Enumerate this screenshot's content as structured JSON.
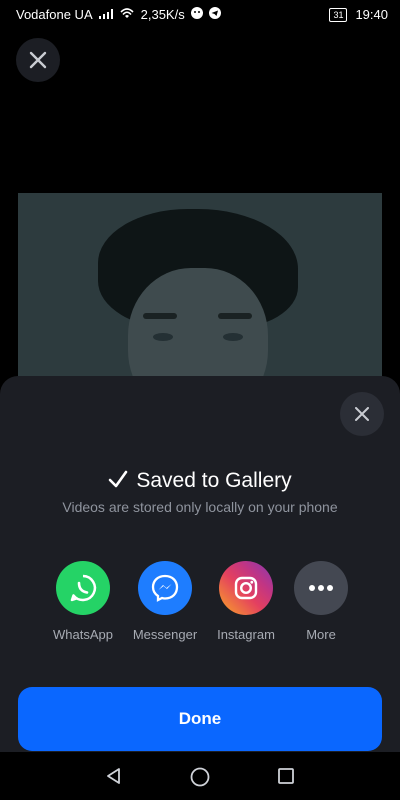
{
  "statusbar": {
    "carrier": "Vodafone UA",
    "speed": "2,35K/s",
    "battery": "31",
    "time": "19:40"
  },
  "sheet": {
    "title": "Saved to Gallery",
    "subtitle": "Videos are stored only locally on your phone",
    "share_options": [
      {
        "label": "WhatsApp",
        "icon": "whatsapp-icon"
      },
      {
        "label": "Messenger",
        "icon": "messenger-icon"
      },
      {
        "label": "Instagram",
        "icon": "instagram-icon"
      },
      {
        "label": "More",
        "icon": "more-icon"
      }
    ],
    "done_label": "Done"
  },
  "colors": {
    "accent": "#0a67ff",
    "sheet_bg": "#1c1e24",
    "whatsapp": "#25d366",
    "messenger": "#1e7dff"
  }
}
